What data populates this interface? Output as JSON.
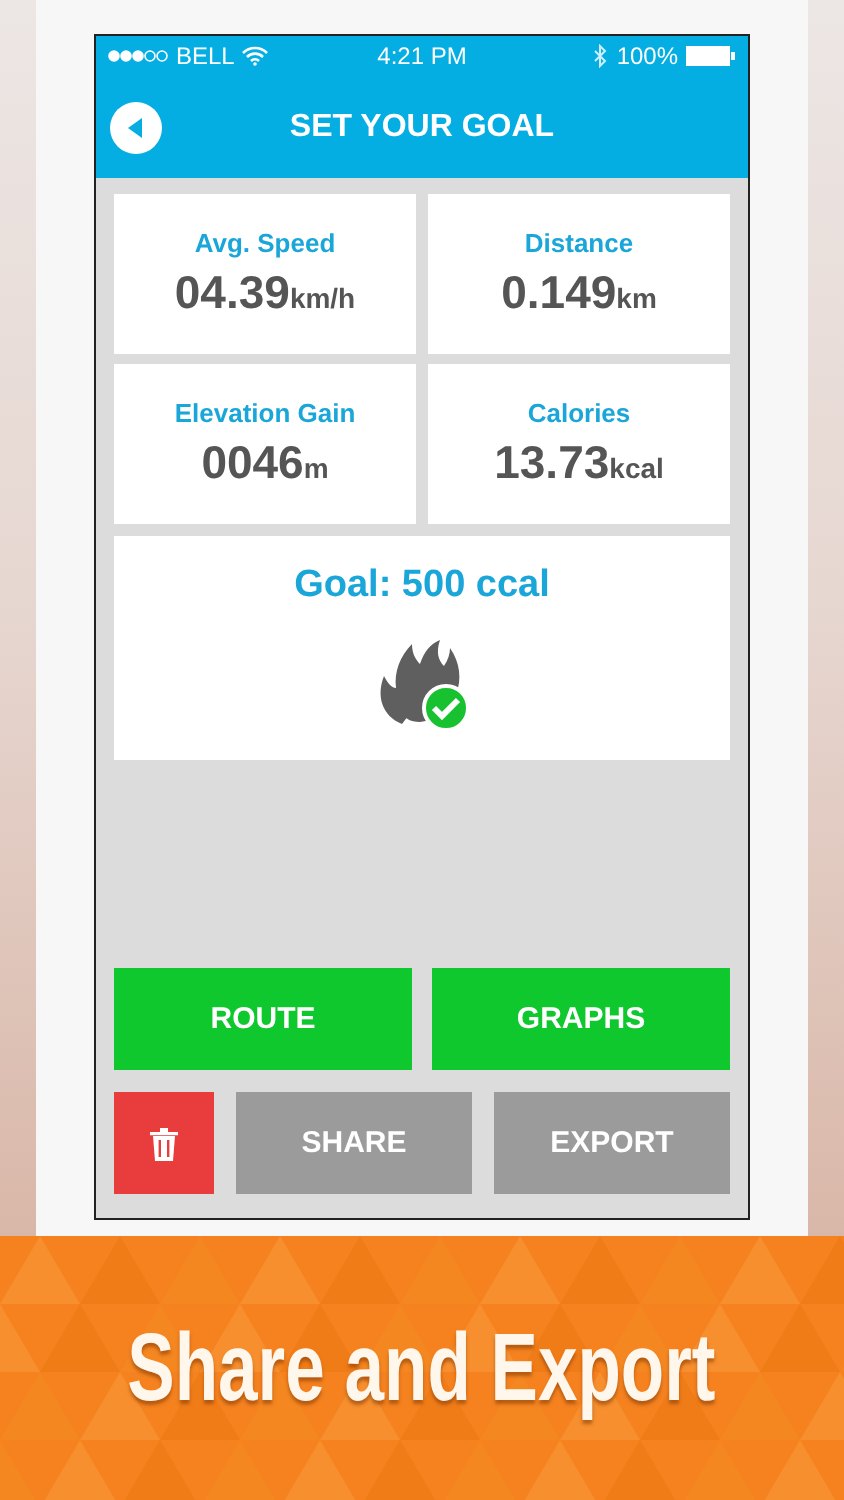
{
  "status_bar": {
    "carrier": "BELL",
    "time": "4:21 PM",
    "battery": "100%"
  },
  "header": {
    "title": "SET YOUR GOAL"
  },
  "stats": [
    {
      "label": "Avg. Speed",
      "value": "04.39",
      "unit": "km/h"
    },
    {
      "label": "Distance",
      "value": "0.149",
      "unit": "km"
    },
    {
      "label": "Elevation Gain",
      "value": "0046",
      "unit": "m"
    },
    {
      "label": "Calories",
      "value": "13.73",
      "unit": "kcal"
    }
  ],
  "goal": {
    "text": "Goal: 500 ccal",
    "achieved": true
  },
  "buttons": [
    {
      "kind": "primary",
      "label": "ROUTE"
    },
    {
      "kind": "primary",
      "label": "GRAPHS"
    },
    {
      "kind": "delete"
    },
    {
      "kind": "secondary",
      "label": "SHARE"
    },
    {
      "kind": "secondary",
      "label": "EXPORT"
    }
  ],
  "banner": {
    "caption": "Share and Export"
  }
}
